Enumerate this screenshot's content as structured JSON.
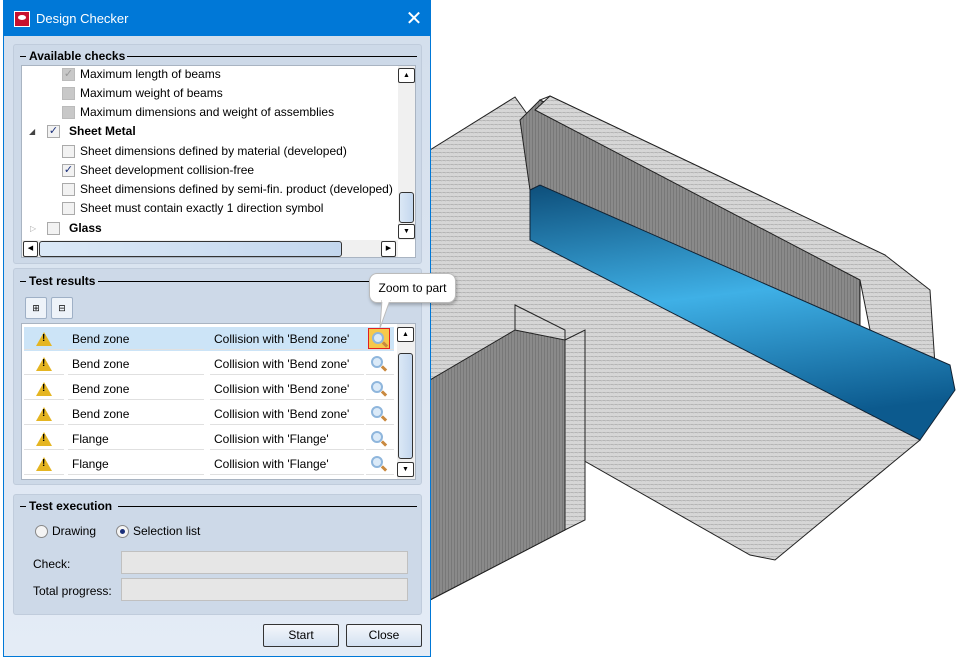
{
  "window": {
    "title": "Design Checker",
    "close_icon": "close-icon"
  },
  "available_checks": {
    "title": "Available checks",
    "items": [
      {
        "label": "Maximum length of beams",
        "state": "checked-disabled"
      },
      {
        "label": "Maximum weight of beams",
        "state": "disabled"
      },
      {
        "label": "Maximum dimensions and weight of assemblies",
        "state": "disabled"
      },
      {
        "label": "Sheet Metal",
        "state": "checked",
        "group": true,
        "expanded": true
      },
      {
        "label": "Sheet dimensions defined by material (developed)",
        "state": "unchecked"
      },
      {
        "label": "Sheet development collision-free",
        "state": "checked"
      },
      {
        "label": "Sheet dimensions defined by semi-fin. product (developed)",
        "state": "unchecked"
      },
      {
        "label": "Sheet must contain exactly 1 direction symbol",
        "state": "unchecked"
      },
      {
        "label": "Glass",
        "state": "unchecked",
        "group": true,
        "expanded": false
      }
    ]
  },
  "test_results": {
    "title": "Test results",
    "tooltip": "Zoom to part",
    "rows": [
      {
        "name": "Bend zone",
        "description": "Collision with 'Bend zone'",
        "selected": true
      },
      {
        "name": "Bend zone",
        "description": "Collision with 'Bend zone'"
      },
      {
        "name": "Bend zone",
        "description": "Collision with 'Bend zone'"
      },
      {
        "name": "Bend zone",
        "description": "Collision with 'Bend zone'"
      },
      {
        "name": "Flange",
        "description": "Collision with 'Flange'"
      },
      {
        "name": "Flange",
        "description": "Collision with 'Flange'"
      }
    ]
  },
  "test_execution": {
    "title": "Test execution",
    "radio_drawing": "Drawing",
    "radio_selection": "Selection list",
    "selected": "Selection list",
    "check_label": "Check:",
    "total_label": "Total progress:"
  },
  "buttons": {
    "start": "Start",
    "close": "Close"
  },
  "colors": {
    "titlebar": "#0078d7",
    "bend_highlight": "#2a8fc8"
  }
}
